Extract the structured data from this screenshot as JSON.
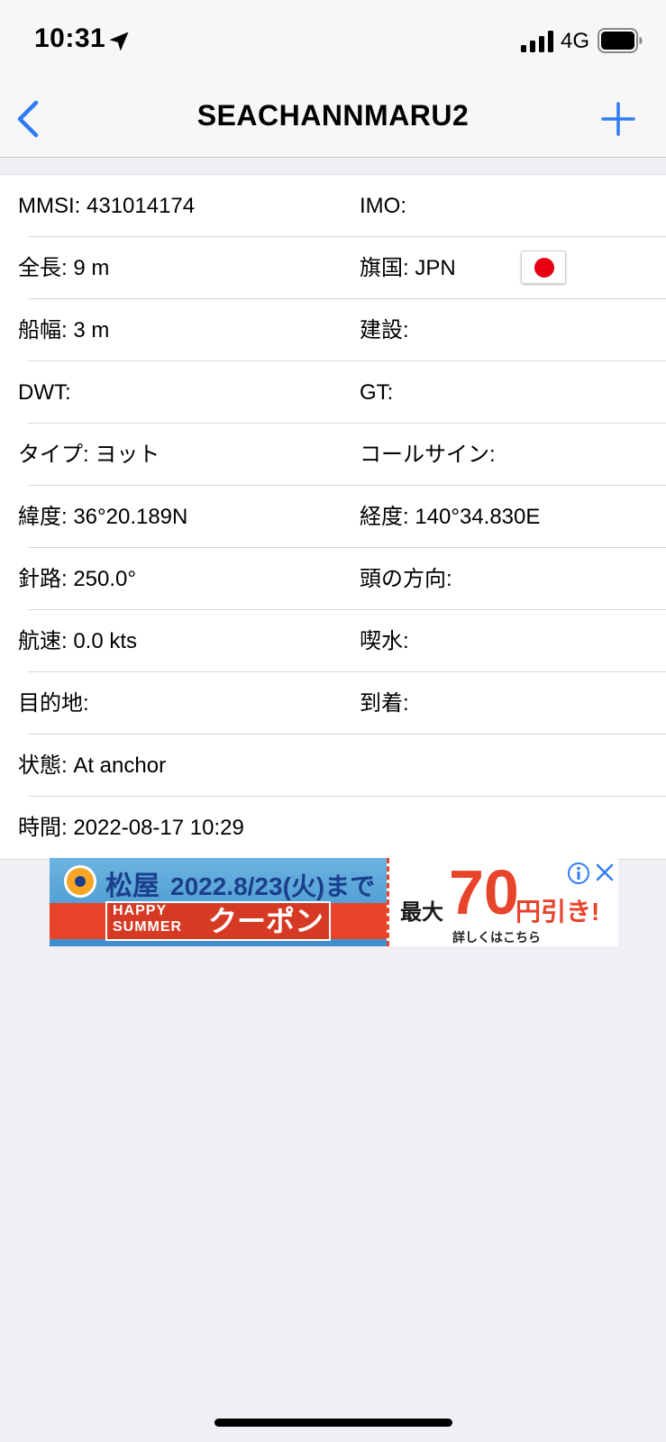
{
  "status_bar": {
    "time": "10:31",
    "network": "4G"
  },
  "nav": {
    "title": "SEACHANNMARU2"
  },
  "rows": [
    {
      "left": "MMSI: 431014174",
      "right": "IMO:"
    },
    {
      "left": "全長: 9 m",
      "right": "旗国: JPN"
    },
    {
      "left": "船幅: 3 m",
      "right": "建設:"
    },
    {
      "left": "DWT:",
      "right": "GT:"
    },
    {
      "left": "タイプ: ヨット",
      "right": "コールサイン:"
    },
    {
      "left": "緯度: 36°20.189N",
      "right": "経度: 140°34.830E"
    },
    {
      "left": "針路: 250.0°",
      "right": "頭の方向:"
    },
    {
      "left": "航速: 0.0 kts",
      "right": "喫水:"
    },
    {
      "left": "目的地:",
      "right": "到着:"
    },
    {
      "left": "状態: At anchor",
      "right": ""
    },
    {
      "left": "時間: 2022-08-17 10:29",
      "right": ""
    }
  ],
  "flag": {
    "icon": "japan-flag-icon",
    "colors": {
      "field": "#ffffff",
      "disc": "#e60012"
    }
  },
  "ad": {
    "brand": "松屋",
    "date_text": "2022.8/23(火)まで",
    "happy_summer": "HAPPY SUMMER",
    "coupon": "クーポン",
    "max_label": "最大",
    "amount": "70",
    "discount_text": "円引き!",
    "details": "詳しくはこちら"
  },
  "colors": {
    "accent": "#2f7cf6",
    "background": "#efeff4"
  }
}
